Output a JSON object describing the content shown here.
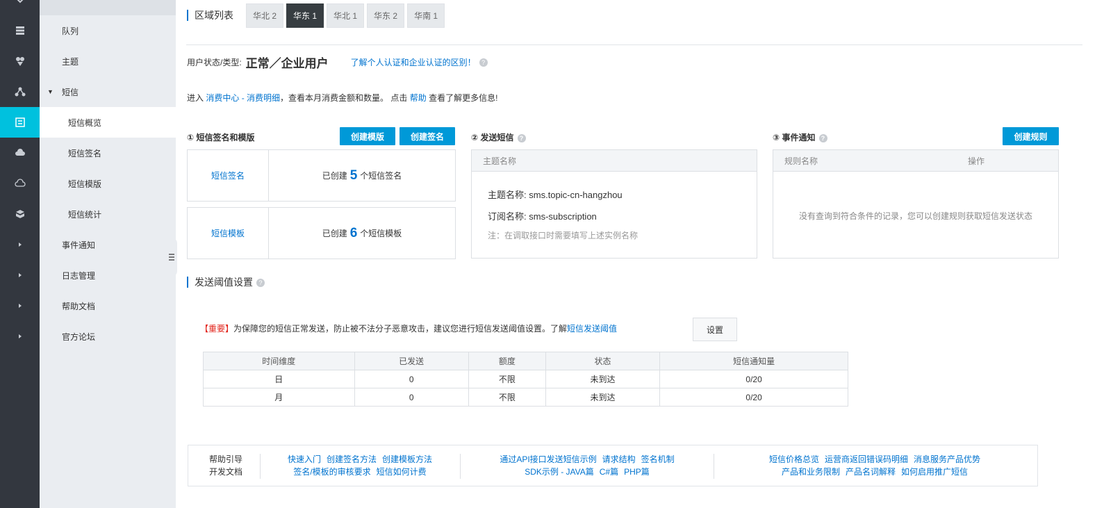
{
  "rail": {
    "icons": [
      "layers-icon",
      "gem-icon",
      "network-icon",
      "message-icon",
      "cloud-icon",
      "cloud-outline-icon",
      "box-icon",
      "chevron-right-icon",
      "chevron-right-icon",
      "chevron-right-icon",
      "chevron-right-icon"
    ]
  },
  "subnav": {
    "items": [
      {
        "label": "队列"
      },
      {
        "label": "主题"
      },
      {
        "label": "短信"
      },
      {
        "label": "短信概览"
      },
      {
        "label": "短信签名"
      },
      {
        "label": "短信模版"
      },
      {
        "label": "短信统计"
      },
      {
        "label": "事件通知"
      },
      {
        "label": "日志管理"
      },
      {
        "label": "帮助文档"
      },
      {
        "label": "官方论坛"
      }
    ]
  },
  "regions": {
    "title": "区域列表",
    "tabs": [
      "华北 2",
      "华东 1",
      "华北 1",
      "华东 2",
      "华南 1"
    ],
    "active": "华东 1"
  },
  "user": {
    "label": "用户状态/类型:",
    "value": "正常／企业用户",
    "link": "了解个人认证和企业认证的区别！"
  },
  "consume": {
    "prefix": "进入",
    "link1": "消费中心 - 消费明细",
    "middle": "，查看本月消费金额和数量。 点击",
    "link2": "帮助",
    "suffix": "查看了解更多信息!"
  },
  "sign_template": {
    "title": "① 短信签名和模版",
    "btn_create_template": "创建模版",
    "btn_create_sign": "创建签名",
    "sign_link": "短信签名",
    "sign_prefix": "已创建",
    "sign_count": "5",
    "sign_suffix": "个短信签名",
    "template_link": "短信模板",
    "template_prefix": "已创建",
    "template_count": "6",
    "template_suffix": "个短信模板"
  },
  "send": {
    "title": "② 发送短信",
    "head": "主题名称",
    "topic_label": "主题名称:",
    "topic_value": "sms.topic-cn-hangzhou",
    "sub_label": "订阅名称:",
    "sub_value": "sms-subscription",
    "note": "注：在调取接口时需要填写上述实例名称"
  },
  "events": {
    "title": "③ 事件通知",
    "btn_create_rule": "创建规则",
    "col_rule": "规则名称",
    "col_op": "操作",
    "empty": "没有查询到符合条件的记录，您可以创建规则获取短信发送状态"
  },
  "threshold": {
    "title": "发送阈值设置",
    "warn_tag": "【重要】",
    "warn_text": "为保障您的短信正常发送，防止被不法分子恶意攻击，建议您进行短信发送阈值设置。了解",
    "warn_link": "短信发送阈值",
    "set_button": "设置",
    "headers": [
      "时间维度",
      "已发送",
      "额度",
      "状态",
      "短信通知量"
    ],
    "rows": [
      [
        "日",
        "0",
        "不限",
        "未到达",
        "0/20"
      ],
      [
        "月",
        "0",
        "不限",
        "未到达",
        "0/20"
      ]
    ]
  },
  "help": {
    "label1": "帮助引导",
    "label2": "开发文档",
    "col1_line1": [
      "快速入门",
      "创建签名方法",
      "创建模板方法"
    ],
    "col1_line2": [
      "签名/模板的审核要求",
      "短信如何计费"
    ],
    "col2_line1": [
      "通过API接口发送短信示例",
      "请求结构",
      "签名机制"
    ],
    "col2_line2": [
      "SDK示例 - JAVA篇",
      "C#篇",
      "PHP篇"
    ],
    "col3_line1": [
      "短信价格总览",
      "运营商返回错误码明细",
      "消息服务产品优势"
    ],
    "col3_line2": [
      "产品和业务限制",
      "产品名词解释",
      "如何启用推广短信"
    ]
  },
  "colors": {
    "rail_bg": "#33373f",
    "rail_active": "#00c1de",
    "link": "#0073cf",
    "primary_button": "#0099d8",
    "warning": "#e2231a"
  }
}
